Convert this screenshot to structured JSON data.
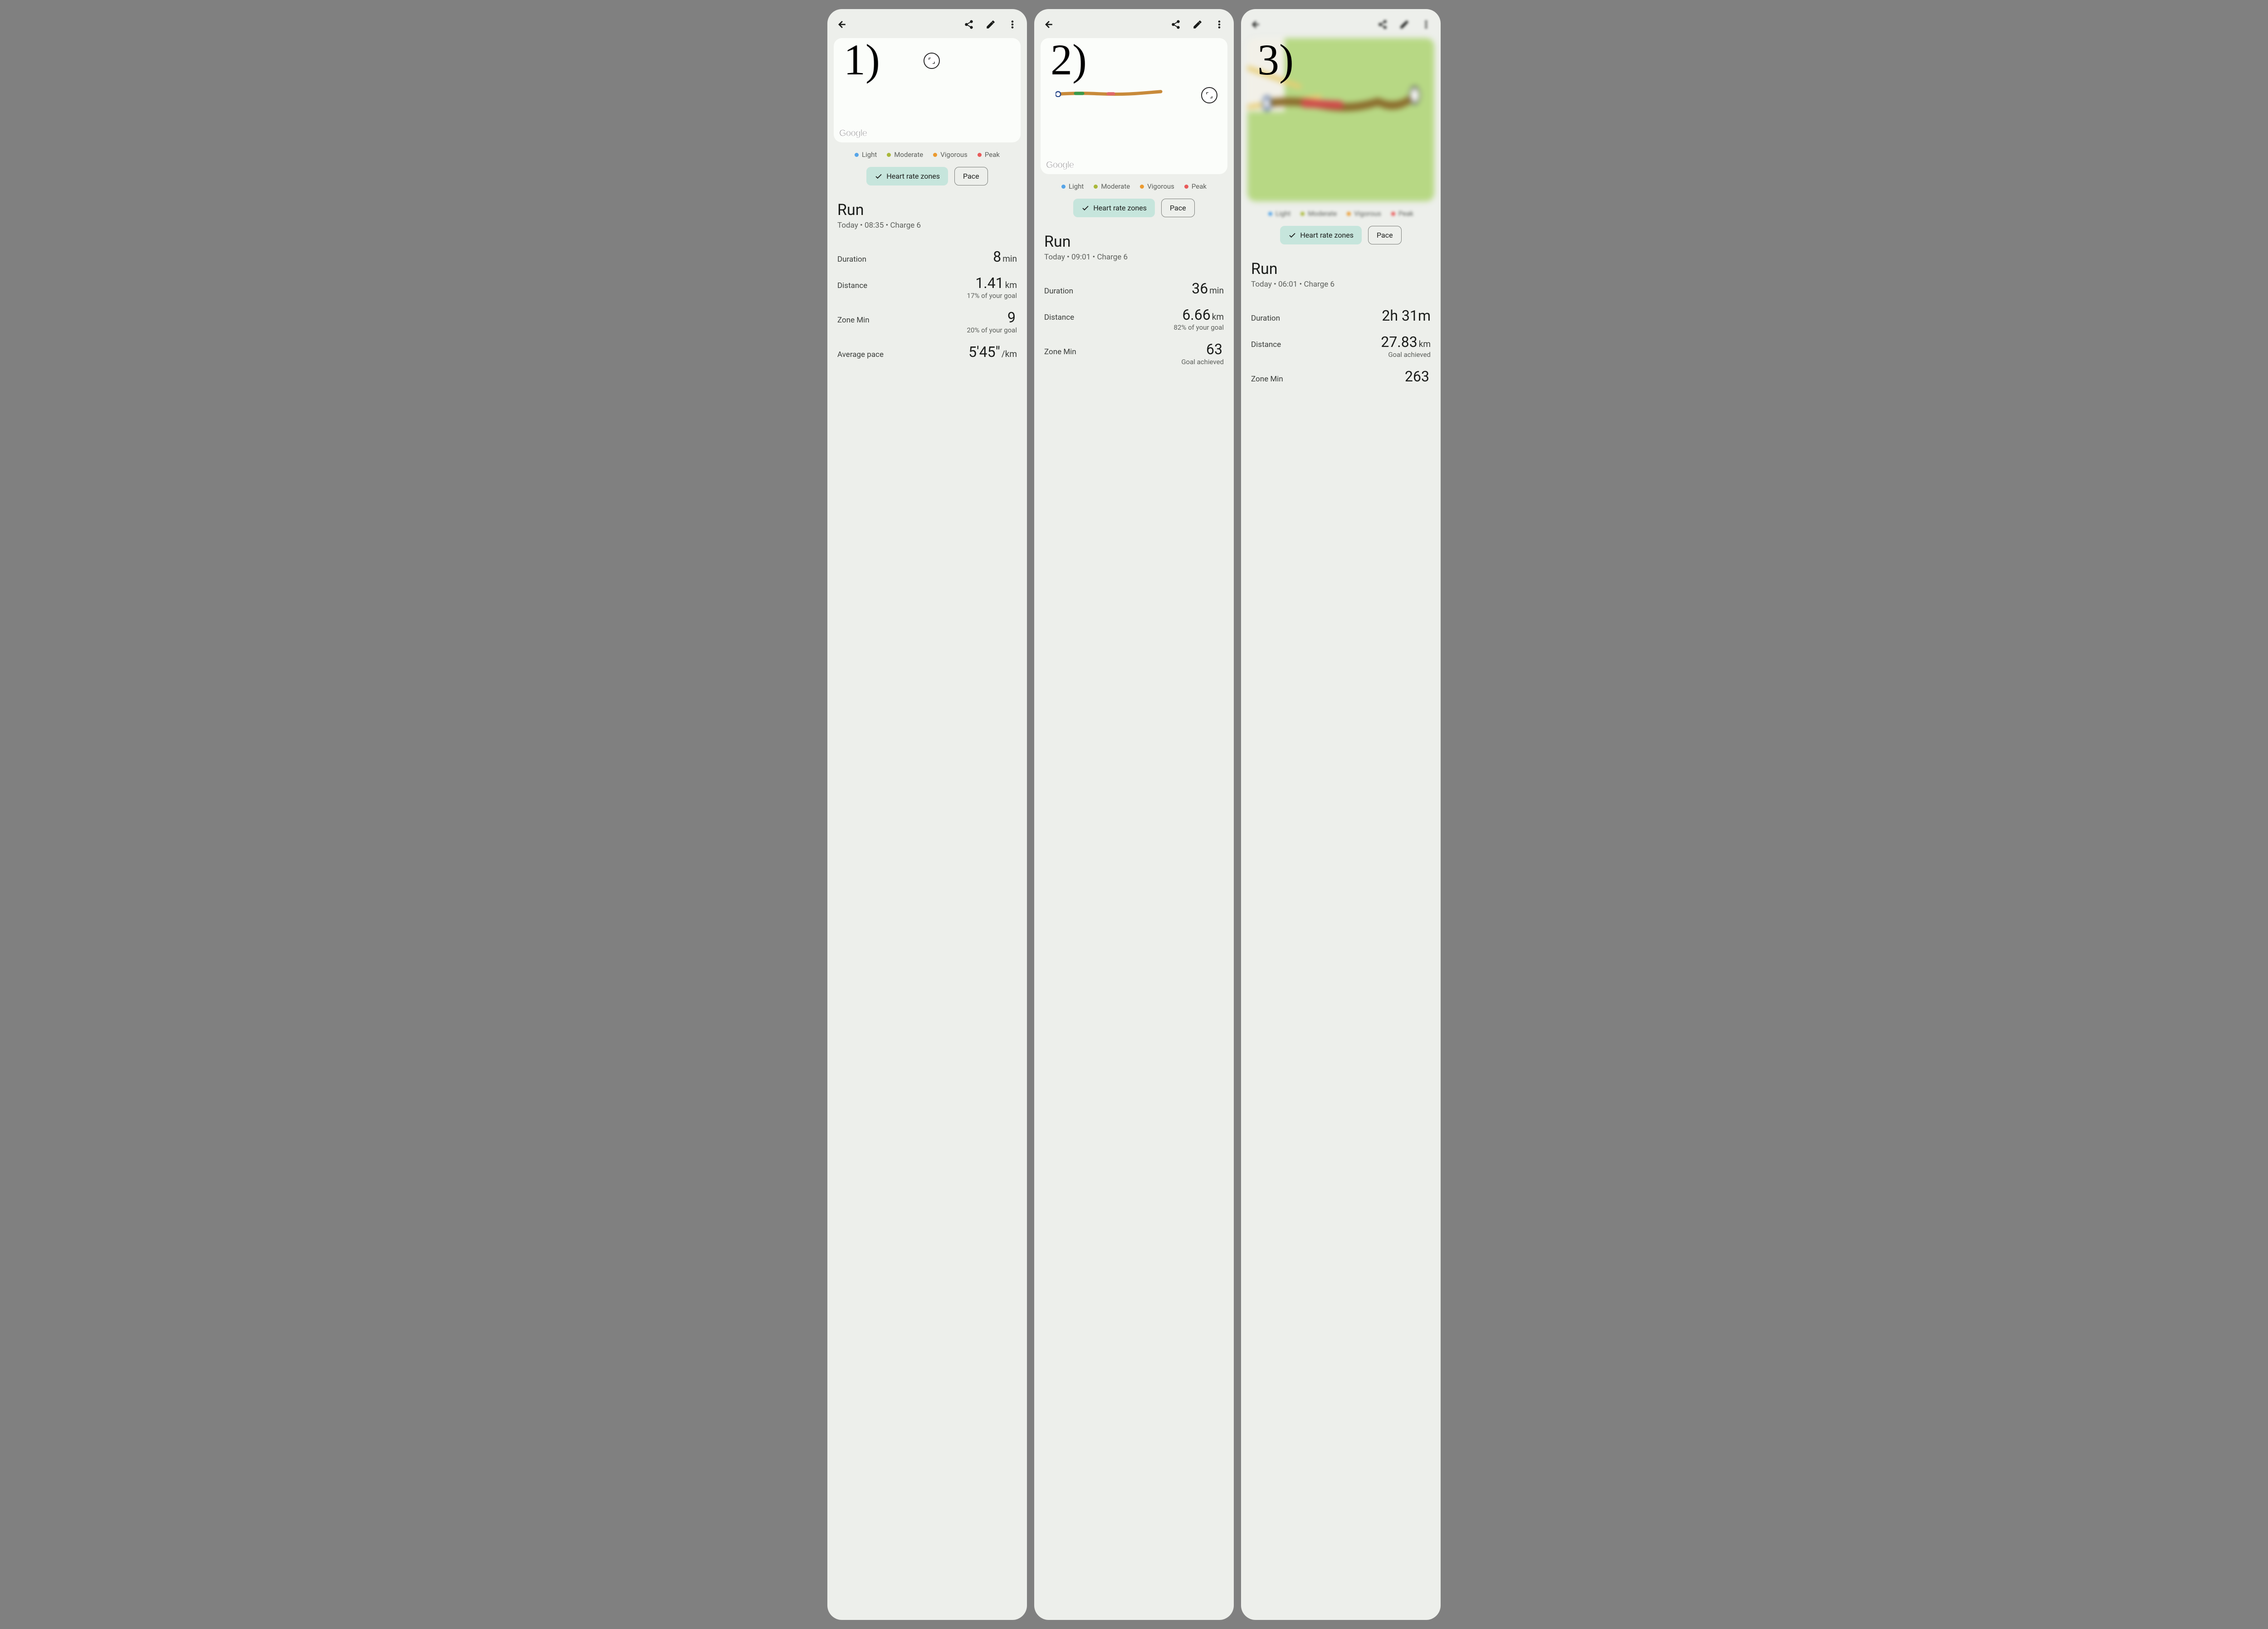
{
  "labels": {
    "one": "1)",
    "two": "2)",
    "three": "3)"
  },
  "common": {
    "map_attribution": "Google",
    "zones": [
      {
        "name": "Light",
        "color": "#56a5e8"
      },
      {
        "name": "Moderate",
        "color": "#a9b83a"
      },
      {
        "name": "Vigorous",
        "color": "#eb9a2f"
      },
      {
        "name": "Peak",
        "color": "#e85a5a"
      }
    ],
    "toggle_hr": "Heart rate zones",
    "toggle_pace": "Pace",
    "icons": {
      "back": "back-arrow",
      "share": "share",
      "edit": "pencil",
      "more": "more-vert",
      "fullscreen": "fullscreen"
    }
  },
  "s1": {
    "title": "Run",
    "subtitle": "Today • 08:35 • Charge 6",
    "rows": [
      {
        "label": "Duration",
        "value": "8",
        "unit": "min",
        "sub": ""
      },
      {
        "label": "Distance",
        "value": "1.41",
        "unit": "km",
        "sub": "17% of your goal"
      },
      {
        "label": "Zone Min",
        "value": "9",
        "unit": "",
        "sub": "20% of your goal"
      },
      {
        "label": "Average pace",
        "value": "5'45\"",
        "unit": "/km",
        "sub": ""
      }
    ]
  },
  "s2": {
    "title": "Run",
    "subtitle": "Today • 09:01 • Charge 6",
    "rows": [
      {
        "label": "Duration",
        "value": "36",
        "unit": "min",
        "sub": ""
      },
      {
        "label": "Distance",
        "value": "6.66",
        "unit": "km",
        "sub": "82% of your goal"
      },
      {
        "label": "Zone Min",
        "value": "63",
        "unit": "",
        "sub": "Goal achieved"
      }
    ]
  },
  "s3": {
    "title": "Run",
    "subtitle": "Today • 06:01 • Charge 6",
    "rows": [
      {
        "label": "Duration",
        "value_compound": "2h 31m",
        "sub": ""
      },
      {
        "label": "Distance",
        "value": "27.83",
        "unit": "km",
        "sub": "Goal achieved"
      },
      {
        "label": "Zone Min",
        "value": "263",
        "unit": "",
        "sub": ""
      }
    ]
  }
}
